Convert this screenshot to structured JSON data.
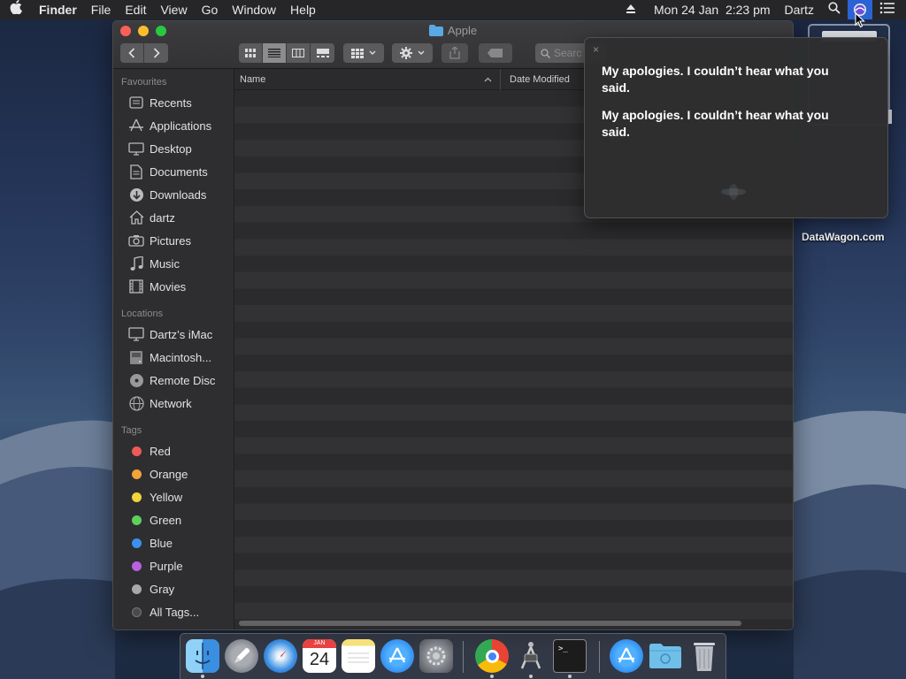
{
  "menubar": {
    "app_name": "Finder",
    "menus": [
      "File",
      "Edit",
      "View",
      "Go",
      "Window",
      "Help"
    ],
    "datetime": "Mon 24 Jan  2:23 pm",
    "user": "Dartz"
  },
  "finder": {
    "title": "Apple",
    "search_placeholder": "Searc",
    "columns": {
      "name": "Name",
      "date_modified": "Date Modified"
    },
    "sidebar": {
      "favourites_header": "Favourites",
      "favourites": [
        {
          "label": "Recents",
          "icon": "recents-icon"
        },
        {
          "label": "Applications",
          "icon": "applications-icon"
        },
        {
          "label": "Desktop",
          "icon": "desktop-icon"
        },
        {
          "label": "Documents",
          "icon": "documents-icon"
        },
        {
          "label": "Downloads",
          "icon": "downloads-icon"
        },
        {
          "label": "dartz",
          "icon": "home-icon"
        },
        {
          "label": "Pictures",
          "icon": "camera-icon"
        },
        {
          "label": "Music",
          "icon": "music-icon"
        },
        {
          "label": "Movies",
          "icon": "film-icon"
        }
      ],
      "locations_header": "Locations",
      "locations": [
        {
          "label": "Dartz’s iMac",
          "icon": "imac-icon"
        },
        {
          "label": "Macintosh...",
          "icon": "disk-icon"
        },
        {
          "label": "Remote Disc",
          "icon": "disc-icon"
        },
        {
          "label": "Network",
          "icon": "network-icon"
        }
      ],
      "tags_header": "Tags",
      "tags": [
        {
          "label": "Red",
          "color": "#ee5a58"
        },
        {
          "label": "Orange",
          "color": "#f4a33a"
        },
        {
          "label": "Yellow",
          "color": "#f2d43a"
        },
        {
          "label": "Green",
          "color": "#5bd15a"
        },
        {
          "label": "Blue",
          "color": "#3d8ff0"
        },
        {
          "label": "Purple",
          "color": "#b960e0"
        },
        {
          "label": "Gray",
          "color": "#a8a8aa"
        },
        {
          "label": "All Tags...",
          "color": "#4a4a4c"
        }
      ]
    }
  },
  "siri": {
    "close_glyph": "×",
    "messages": [
      "My apologies. I couldn’t hear what you said.",
      "My apologies. I couldn’t hear what you said."
    ]
  },
  "desktop": {
    "watermark": "DataWagon.com"
  },
  "dock": {
    "items": [
      {
        "name": "finder",
        "running": true
      },
      {
        "name": "launchpad",
        "running": false
      },
      {
        "name": "safari",
        "running": false
      },
      {
        "name": "calendar",
        "running": false,
        "month": "JAN",
        "day": "24"
      },
      {
        "name": "notes",
        "running": false
      },
      {
        "name": "app-store",
        "running": false
      },
      {
        "name": "system-preferences",
        "running": false
      },
      {
        "name": "chrome",
        "running": true
      },
      {
        "name": "automator",
        "running": true
      },
      {
        "name": "terminal",
        "running": true
      },
      {
        "name": "app-store-2",
        "running": false
      },
      {
        "name": "folder",
        "running": false
      },
      {
        "name": "trash",
        "running": false
      }
    ]
  },
  "colors": {
    "accent": "#2c63d4",
    "window_bg": "#2b2b2d"
  }
}
